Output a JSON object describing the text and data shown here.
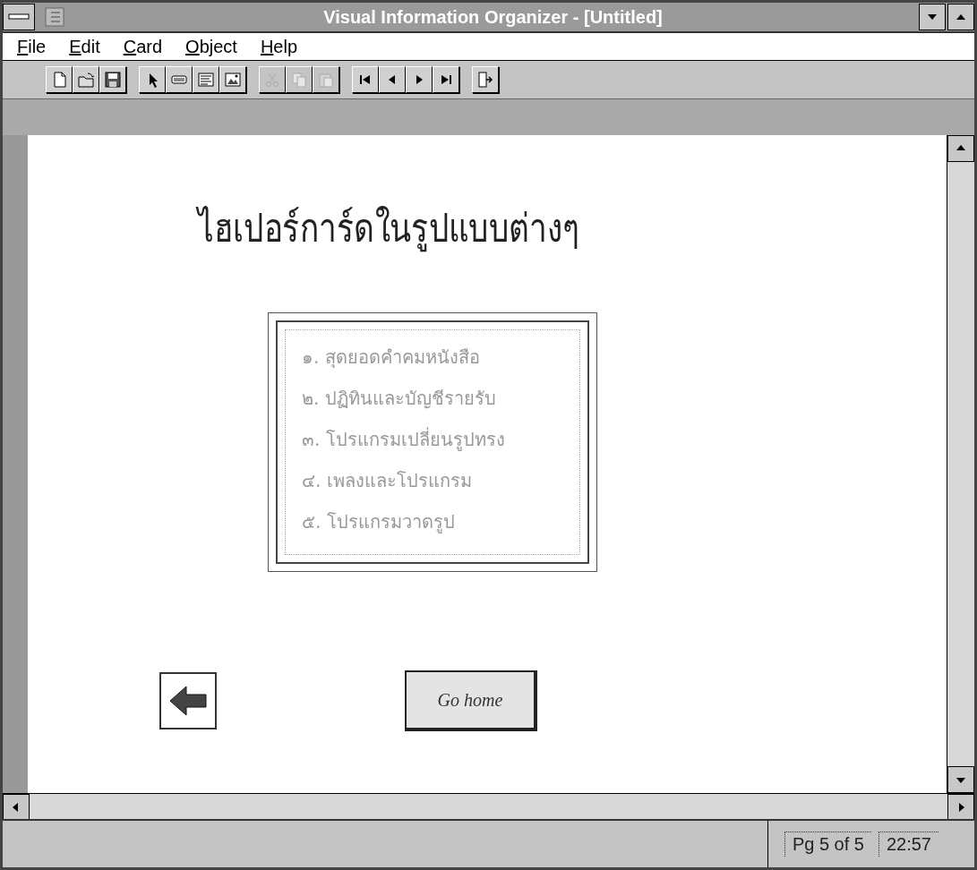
{
  "window": {
    "title": "Visual Information Organizer - [Untitled]"
  },
  "menu": [
    "File",
    "Edit",
    "Card",
    "Object",
    "Help"
  ],
  "toolbar": [
    [
      {
        "kind": "new",
        "disabled": false
      },
      {
        "kind": "open",
        "disabled": false
      },
      {
        "kind": "save",
        "disabled": false
      }
    ],
    [
      {
        "kind": "pointer",
        "disabled": false
      },
      {
        "kind": "button-tool",
        "disabled": false
      },
      {
        "kind": "text-tool",
        "disabled": false
      },
      {
        "kind": "picture-tool",
        "disabled": false
      }
    ],
    [
      {
        "kind": "cut",
        "disabled": true
      },
      {
        "kind": "copy",
        "disabled": true
      },
      {
        "kind": "paste",
        "disabled": true
      }
    ],
    [
      {
        "kind": "first",
        "disabled": false
      },
      {
        "kind": "prev",
        "disabled": false
      },
      {
        "kind": "next",
        "disabled": false
      },
      {
        "kind": "last",
        "disabled": false
      }
    ],
    [
      {
        "kind": "exit",
        "disabled": false
      }
    ]
  ],
  "card": {
    "heading": "ไฮเปอร์การ์ดในรูปแบบต่างๆ",
    "list": [
      "๑. สุดยอดคำคมหนังสือ",
      "๒. ปฏิทินและบัญชีรายรับ",
      "๓. โปรแกรมเปลี่ยนรูปทรง",
      "๔. เพลงและโปรแกรม",
      "๕. โปรแกรมวาดรูป"
    ],
    "home_button": "Go home"
  },
  "status_bar": {
    "page": "Pg 5 of 5",
    "time": "22:57"
  }
}
